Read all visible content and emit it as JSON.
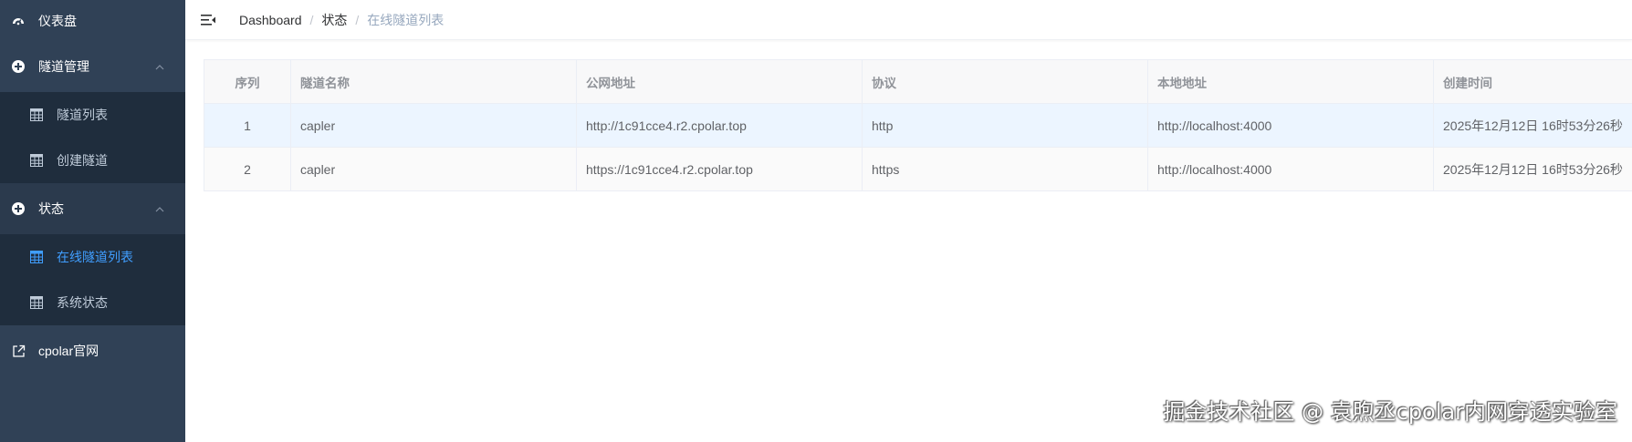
{
  "sidebar": {
    "dashboard": "仪表盘",
    "tunnel_group": "隧道管理",
    "tunnel_items": [
      "隧道列表",
      "创建隧道"
    ],
    "status_group": "状态",
    "status_items": [
      "在线隧道列表",
      "系统状态"
    ],
    "external_link": "cpolar官网"
  },
  "breadcrumb": {
    "home": "Dashboard",
    "parent": "状态",
    "current": "在线隧道列表",
    "separator": "/"
  },
  "table": {
    "headers": [
      "序列",
      "隧道名称",
      "公网地址",
      "协议",
      "本地地址",
      "创建时间"
    ],
    "rows": [
      [
        "1",
        "capler",
        "http://1c91cce4.r2.cpolar.top",
        "http",
        "http://localhost:4000",
        "2025年12月12日 16时53分26秒"
      ],
      [
        "2",
        "capler",
        "https://1c91cce4.r2.cpolar.top",
        "https",
        "http://localhost:4000",
        "2025年12月12日 16时53分26秒"
      ]
    ]
  },
  "watermark": "掘金技术社区 @ 袁煦丞cpolar内网穿透实验室",
  "colors": {
    "sidebar_bg": "#304156",
    "submenu_bg": "#1f2d3d",
    "active": "#409eff",
    "row_highlight": "#ecf5ff"
  },
  "icons": {
    "dashboard": "dashboard-gauge-icon",
    "group": "circle-plus-icon",
    "item": "table-grid-icon",
    "external": "external-link-icon",
    "toggle": "hamburger-icon",
    "chevron": "chevron-up-icon"
  }
}
